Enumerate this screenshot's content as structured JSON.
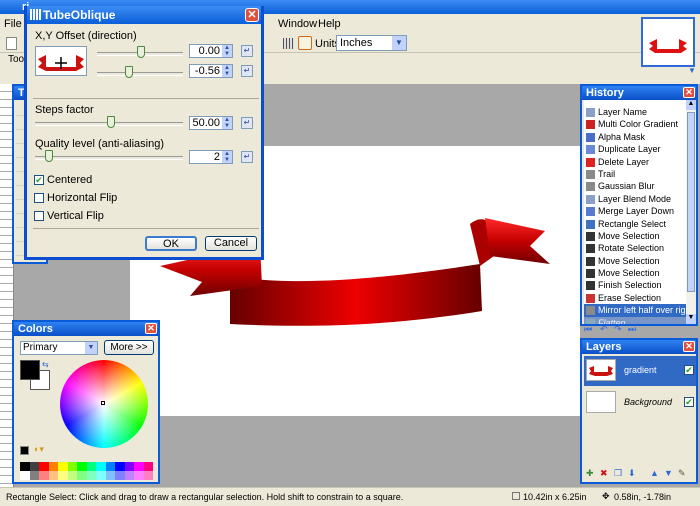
{
  "window": {
    "title_fragment": "ri"
  },
  "menu": {
    "file": "File",
    "window": "Window",
    "help": "Help"
  },
  "toolbar": {
    "units_label": "Units:",
    "units_value": "Inches",
    "tools_label": "Tool"
  },
  "dialog": {
    "title": "TubeOblique",
    "offset_label": "X,Y Offset (direction)",
    "x_value": "0.00",
    "y_value": "-0.56",
    "steps_label": "Steps factor",
    "steps_value": "50.00",
    "quality_label": "Quality level (anti-aliasing)",
    "quality_value": "2",
    "centered_label": "Centered",
    "centered_checked": true,
    "hflip_label": "Horizontal Flip",
    "hflip_checked": false,
    "vflip_label": "Vertical Flip",
    "vflip_checked": false,
    "ok_label": "OK",
    "cancel_label": "Cancel"
  },
  "history": {
    "title": "History",
    "items": [
      {
        "label": "Layer Name",
        "icon": "layer-props-icon"
      },
      {
        "label": "Multi Color Gradient",
        "icon": "gradient-icon"
      },
      {
        "label": "Alpha Mask",
        "icon": "mask-icon"
      },
      {
        "label": "Duplicate Layer",
        "icon": "duplicate-icon"
      },
      {
        "label": "Delete Layer",
        "icon": "delete-icon"
      },
      {
        "label": "Trail",
        "icon": "effect-icon"
      },
      {
        "label": "Gaussian Blur",
        "icon": "effect-icon"
      },
      {
        "label": "Layer Blend Mode",
        "icon": "layer-props-icon"
      },
      {
        "label": "Merge Layer Down",
        "icon": "merge-icon"
      },
      {
        "label": "Rectangle Select",
        "icon": "select-icon"
      },
      {
        "label": "Move Selection",
        "icon": "move-icon"
      },
      {
        "label": "Rotate Selection",
        "icon": "move-icon"
      },
      {
        "label": "Move Selection",
        "icon": "move-icon"
      },
      {
        "label": "Move Selection",
        "icon": "move-icon"
      },
      {
        "label": "Finish Selection",
        "icon": "move-icon"
      },
      {
        "label": "Erase Selection",
        "icon": "erase-icon"
      },
      {
        "label": "Mirror left half over right ...",
        "icon": "effect-icon"
      },
      {
        "label": "Flatten",
        "icon": "flatten-icon"
      }
    ]
  },
  "layers": {
    "title": "Layers",
    "items": [
      {
        "name": "gradient",
        "visible": true
      },
      {
        "name": "Background",
        "visible": true
      }
    ]
  },
  "colors": {
    "title": "Colors",
    "mode": "Primary",
    "more_label": "More >>",
    "primary": "#000000",
    "secondary": "#ffffff"
  },
  "status": {
    "hint": "Rectangle Select: Click and drag to draw a rectangular selection. Hold shift to constrain to a square.",
    "size": "10.42in x 6.25in",
    "pos": "0.58in, -1.78in"
  }
}
